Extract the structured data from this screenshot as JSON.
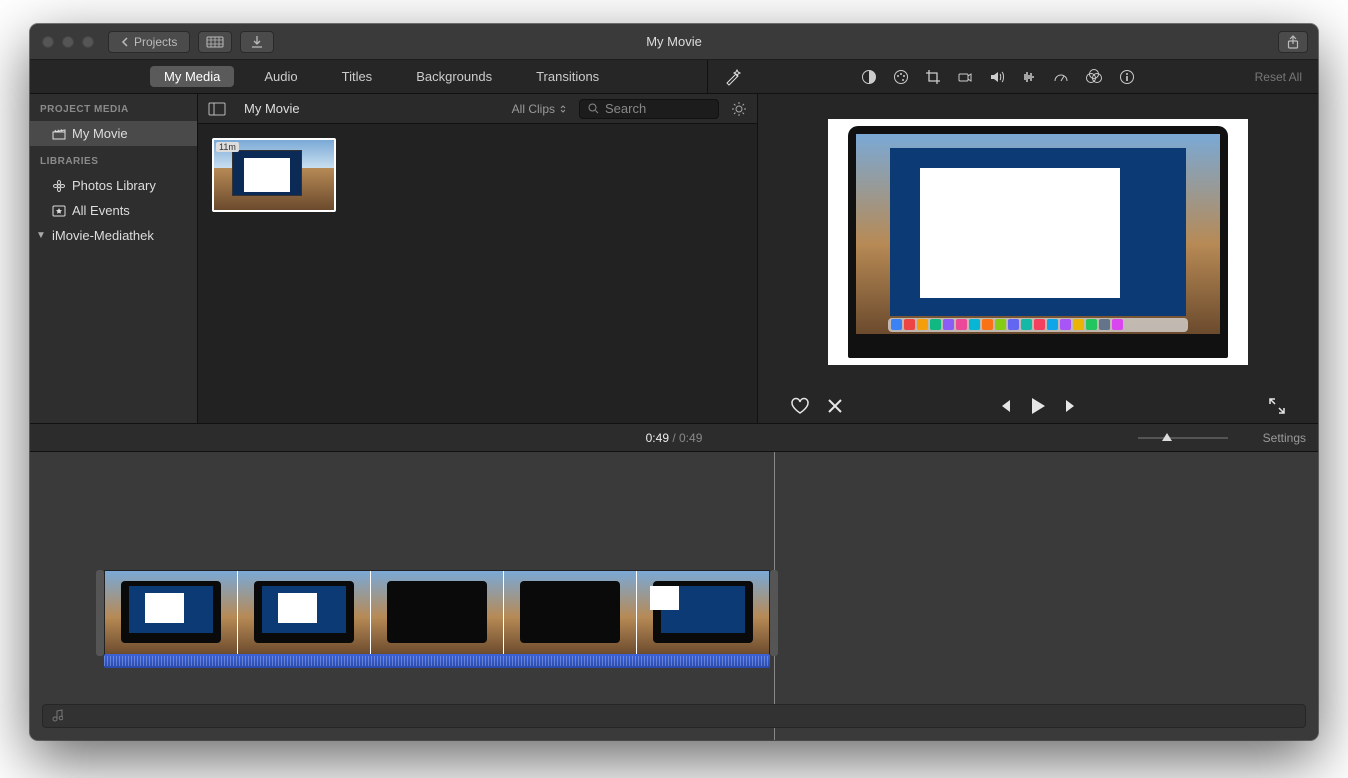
{
  "titlebar": {
    "projects_label": "Projects",
    "window_title": "My Movie"
  },
  "tabs": [
    {
      "label": "My Media",
      "active": true
    },
    {
      "label": "Audio",
      "active": false
    },
    {
      "label": "Titles",
      "active": false
    },
    {
      "label": "Backgrounds",
      "active": false
    },
    {
      "label": "Transitions",
      "active": false
    }
  ],
  "adjust": {
    "reset_label": "Reset All"
  },
  "sidebar": {
    "header_project": "PROJECT MEDIA",
    "project_item": "My Movie",
    "header_libraries": "LIBRARIES",
    "photos_library": "Photos Library",
    "all_events": "All Events",
    "mediathek": "iMovie-Mediathek"
  },
  "browser": {
    "title": "My Movie",
    "filter_label": "All Clips",
    "search_placeholder": "Search",
    "thumb_badge": "11m"
  },
  "timeline": {
    "current": "0:49",
    "duration": "0:49",
    "settings_label": "Settings"
  },
  "dock_colors": [
    "#3b82f6",
    "#ef4444",
    "#f59e0b",
    "#10b981",
    "#8b5cf6",
    "#ec4899",
    "#06b6d4",
    "#f97316",
    "#84cc16",
    "#6366f1",
    "#14b8a6",
    "#f43f5e",
    "#0ea5e9",
    "#a855f7",
    "#eab308",
    "#22c55e",
    "#64748b",
    "#d946ef"
  ]
}
